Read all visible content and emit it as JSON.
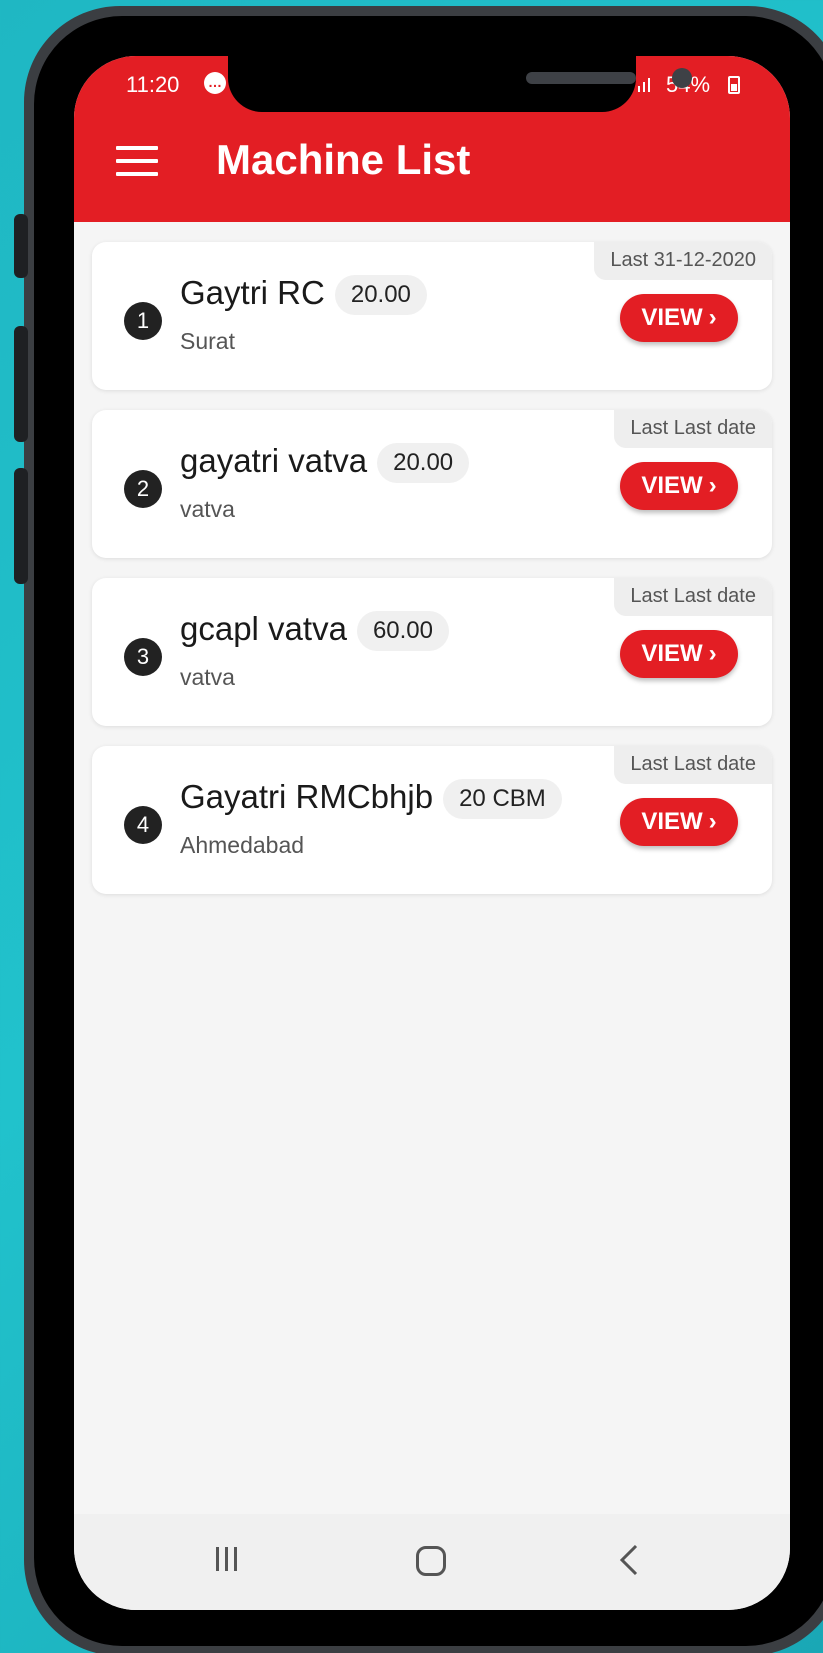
{
  "status_bar": {
    "time": "11:20",
    "battery": "54%"
  },
  "app_bar": {
    "title": "Machine List"
  },
  "machines": [
    {
      "index": "1",
      "name": "Gaytri RC",
      "capacity": "20.00",
      "location": "Surat",
      "last": "Last 31-12-2020",
      "action": "VIEW"
    },
    {
      "index": "2",
      "name": "gayatri vatva",
      "capacity": "20.00",
      "location": "vatva",
      "last": "Last Last date",
      "action": "VIEW"
    },
    {
      "index": "3",
      "name": "gcapl vatva",
      "capacity": "60.00",
      "location": "vatva",
      "last": "Last Last date",
      "action": "VIEW"
    },
    {
      "index": "4",
      "name": "Gayatri RMCbhjb",
      "capacity": "20 CBM",
      "location": "Ahmedabad",
      "last": "Last Last date",
      "action": "VIEW"
    }
  ],
  "colors": {
    "brand_red": "#e31e24",
    "background": "#f5f5f5",
    "badge_dark": "#222222"
  }
}
